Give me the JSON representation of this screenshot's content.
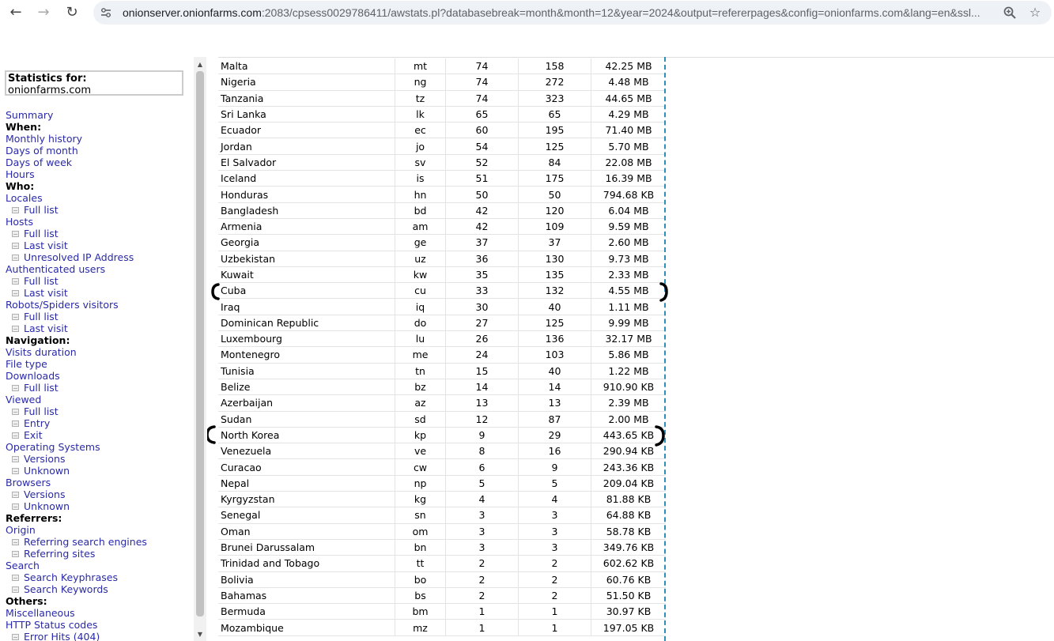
{
  "browser": {
    "url_host": "onionserver.onionfarms.com",
    "url_rest": ":2083/cpsess0029786411/awstats.pl?databasebreak=month&month=12&year=2024&output=refererpages&config=onionfarms.com&lang=en&ssl..."
  },
  "stats_box": {
    "label": "Statistics for:",
    "site": "onionfarms.com"
  },
  "menu": [
    {
      "type": "link",
      "text": "Summary"
    },
    {
      "type": "head",
      "text": "When:"
    },
    {
      "type": "link",
      "text": "Monthly history"
    },
    {
      "type": "link",
      "text": "Days of month"
    },
    {
      "type": "link",
      "text": "Days of week"
    },
    {
      "type": "link",
      "text": "Hours"
    },
    {
      "type": "head",
      "text": "Who:"
    },
    {
      "type": "link",
      "text": "Locales"
    },
    {
      "type": "sub",
      "text": "Full list"
    },
    {
      "type": "link",
      "text": "Hosts"
    },
    {
      "type": "sub",
      "text": "Full list"
    },
    {
      "type": "sub",
      "text": "Last visit"
    },
    {
      "type": "sub",
      "text": "Unresolved IP Address"
    },
    {
      "type": "link",
      "text": "Authenticated users"
    },
    {
      "type": "sub",
      "text": "Full list"
    },
    {
      "type": "sub",
      "text": "Last visit"
    },
    {
      "type": "link",
      "text": "Robots/Spiders visitors"
    },
    {
      "type": "sub",
      "text": "Full list"
    },
    {
      "type": "sub",
      "text": "Last visit"
    },
    {
      "type": "head",
      "text": "Navigation:"
    },
    {
      "type": "link",
      "text": "Visits duration"
    },
    {
      "type": "link",
      "text": "File type"
    },
    {
      "type": "link",
      "text": "Downloads"
    },
    {
      "type": "sub",
      "text": "Full list"
    },
    {
      "type": "link",
      "text": "Viewed"
    },
    {
      "type": "sub",
      "text": "Full list"
    },
    {
      "type": "sub",
      "text": "Entry"
    },
    {
      "type": "sub",
      "text": "Exit"
    },
    {
      "type": "link",
      "text": "Operating Systems"
    },
    {
      "type": "sub",
      "text": "Versions"
    },
    {
      "type": "sub",
      "text": "Unknown"
    },
    {
      "type": "link",
      "text": "Browsers"
    },
    {
      "type": "sub",
      "text": "Versions"
    },
    {
      "type": "sub",
      "text": "Unknown"
    },
    {
      "type": "head",
      "text": "Referrers:"
    },
    {
      "type": "link",
      "text": "Origin"
    },
    {
      "type": "sub",
      "text": "Referring search engines"
    },
    {
      "type": "sub",
      "text": "Referring sites"
    },
    {
      "type": "link",
      "text": "Search"
    },
    {
      "type": "sub",
      "text": "Search Keyphrases"
    },
    {
      "type": "sub",
      "text": "Search Keywords"
    },
    {
      "type": "head",
      "text": "Others:"
    },
    {
      "type": "link",
      "text": "Miscellaneous"
    },
    {
      "type": "link",
      "text": "HTTP Status codes"
    },
    {
      "type": "sub",
      "text": "Error Hits (404)"
    }
  ],
  "countries": [
    [
      "Malta",
      "mt",
      "74",
      "158",
      "42.25 MB"
    ],
    [
      "Nigeria",
      "ng",
      "74",
      "272",
      "4.48 MB"
    ],
    [
      "Tanzania",
      "tz",
      "74",
      "323",
      "44.65 MB"
    ],
    [
      "Sri Lanka",
      "lk",
      "65",
      "65",
      "4.29 MB"
    ],
    [
      "Ecuador",
      "ec",
      "60",
      "195",
      "71.40 MB"
    ],
    [
      "Jordan",
      "jo",
      "54",
      "125",
      "5.70 MB"
    ],
    [
      "El Salvador",
      "sv",
      "52",
      "84",
      "22.08 MB"
    ],
    [
      "Iceland",
      "is",
      "51",
      "175",
      "16.39 MB"
    ],
    [
      "Honduras",
      "hn",
      "50",
      "50",
      "794.68 KB"
    ],
    [
      "Bangladesh",
      "bd",
      "42",
      "120",
      "6.04 MB"
    ],
    [
      "Armenia",
      "am",
      "42",
      "109",
      "9.59 MB"
    ],
    [
      "Georgia",
      "ge",
      "37",
      "37",
      "2.60 MB"
    ],
    [
      "Uzbekistan",
      "uz",
      "36",
      "130",
      "9.73 MB"
    ],
    [
      "Kuwait",
      "kw",
      "35",
      "135",
      "2.33 MB"
    ],
    [
      "Cuba",
      "cu",
      "33",
      "132",
      "4.55 MB"
    ],
    [
      "Iraq",
      "iq",
      "30",
      "40",
      "1.11 MB"
    ],
    [
      "Dominican Republic",
      "do",
      "27",
      "125",
      "9.99 MB"
    ],
    [
      "Luxembourg",
      "lu",
      "26",
      "136",
      "32.17 MB"
    ],
    [
      "Montenegro",
      "me",
      "24",
      "103",
      "5.86 MB"
    ],
    [
      "Tunisia",
      "tn",
      "15",
      "40",
      "1.22 MB"
    ],
    [
      "Belize",
      "bz",
      "14",
      "14",
      "910.90 KB"
    ],
    [
      "Azerbaijan",
      "az",
      "13",
      "13",
      "2.39 MB"
    ],
    [
      "Sudan",
      "sd",
      "12",
      "87",
      "2.00 MB"
    ],
    [
      "North Korea",
      "kp",
      "9",
      "29",
      "443.65 KB"
    ],
    [
      "Venezuela",
      "ve",
      "8",
      "16",
      "290.94 KB"
    ],
    [
      "Curacao",
      "cw",
      "6",
      "9",
      "243.36 KB"
    ],
    [
      "Nepal",
      "np",
      "5",
      "5",
      "209.04 KB"
    ],
    [
      "Kyrgyzstan",
      "kg",
      "4",
      "4",
      "81.88 KB"
    ],
    [
      "Senegal",
      "sn",
      "3",
      "3",
      "64.88 KB"
    ],
    [
      "Oman",
      "om",
      "3",
      "3",
      "58.78 KB"
    ],
    [
      "Brunei Darussalam",
      "bn",
      "3",
      "3",
      "349.76 KB"
    ],
    [
      "Trinidad and Tobago",
      "tt",
      "2",
      "2",
      "602.62 KB"
    ],
    [
      "Bolivia",
      "bo",
      "2",
      "2",
      "60.76 KB"
    ],
    [
      "Bahamas",
      "bs",
      "2",
      "2",
      "51.50 KB"
    ],
    [
      "Bermuda",
      "bm",
      "1",
      "1",
      "30.97 KB"
    ],
    [
      "Mozambique",
      "mz",
      "1",
      "1",
      "197.05 KB"
    ]
  ]
}
